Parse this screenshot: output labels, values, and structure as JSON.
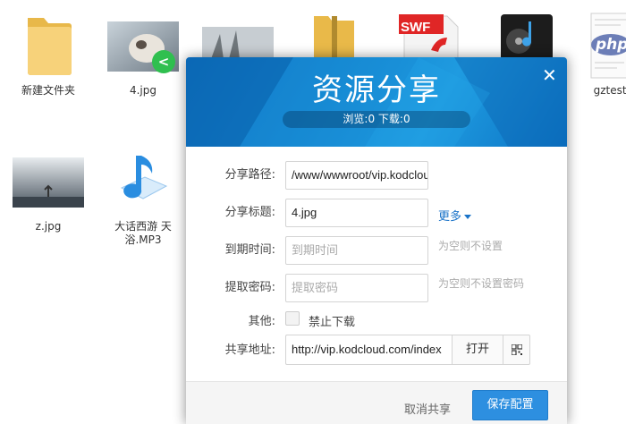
{
  "desktop": {
    "files": [
      {
        "name": "新建文件夹",
        "type": "folder"
      },
      {
        "name": "4.jpg",
        "type": "image"
      },
      {
        "name": "",
        "type": "image"
      },
      {
        "name": "",
        "type": "archive"
      },
      {
        "name": "",
        "type": "swf"
      },
      {
        "name": "",
        "type": "music"
      },
      {
        "name": "gztest.",
        "type": "php"
      },
      {
        "name": "z.jpg",
        "type": "image"
      },
      {
        "name": "大话西游 天浴.MP3",
        "type": "audio"
      }
    ],
    "swf_badge": "SWF",
    "php_badge": "php",
    "shared_icon": "share-icon"
  },
  "dialog": {
    "title": "资源分享",
    "stats": "浏览:0 下载:0",
    "close_icon": "close-icon",
    "fields": {
      "path_label": "分享路径:",
      "path_value": "/www/wwwroot/vip.kodcloud",
      "title_label": "分享标题:",
      "title_value": "4.jpg",
      "more_label": "更多",
      "expire_label": "到期时间:",
      "expire_placeholder": "到期时间",
      "expire_hint": "为空则不设置",
      "password_label": "提取密码:",
      "password_placeholder": "提取密码",
      "password_hint": "为空则不设置密码",
      "other_label": "其他:",
      "no_download_label": "禁止下载",
      "link_label": "共享地址:",
      "link_value": "http://vip.kodcloud.com/index",
      "open_label": "打开",
      "qr_icon": "qrcode-icon"
    },
    "footer": {
      "cancel_label": "取消共享",
      "save_label": "保存配置"
    },
    "colors": {
      "header": "#1689d3",
      "primary_button": "#2d8fe0",
      "link": "#1a73c8"
    }
  }
}
